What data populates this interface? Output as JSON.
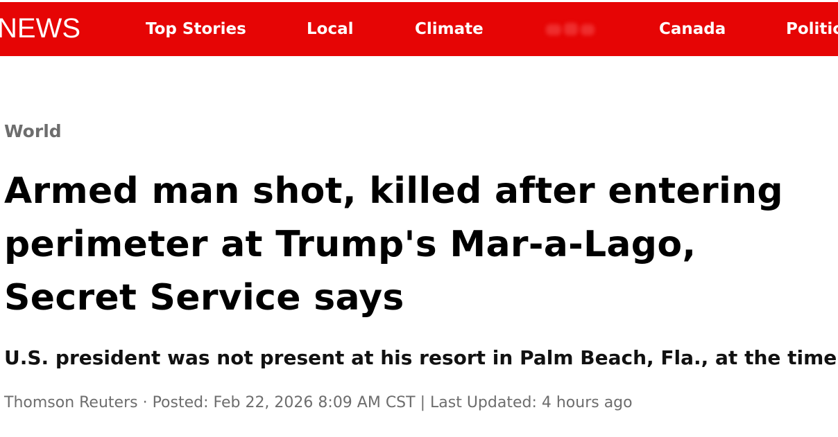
{
  "header": {
    "logo_text": "NEWS",
    "nav": [
      {
        "label": "Top Stories"
      },
      {
        "label": "Local"
      },
      {
        "label": "Climate"
      },
      {
        "label": ""
      },
      {
        "label": "Canada"
      },
      {
        "label": "Politics"
      }
    ],
    "background_color": "#e60505"
  },
  "article": {
    "section": "World",
    "headline": "Armed man shot, killed after entering perimeter at Trump's Mar-a-Lago, Secret Service says",
    "dek": "U.S. president was not present at his resort in Palm Beach, Fla., at the time",
    "byline": {
      "source": "Thomson Reuters",
      "separator": " · ",
      "posted": "Posted: Feb 22, 2026 8:09 AM CST",
      "divider": " | ",
      "updated": "Last Updated: 4 hours ago"
    }
  }
}
